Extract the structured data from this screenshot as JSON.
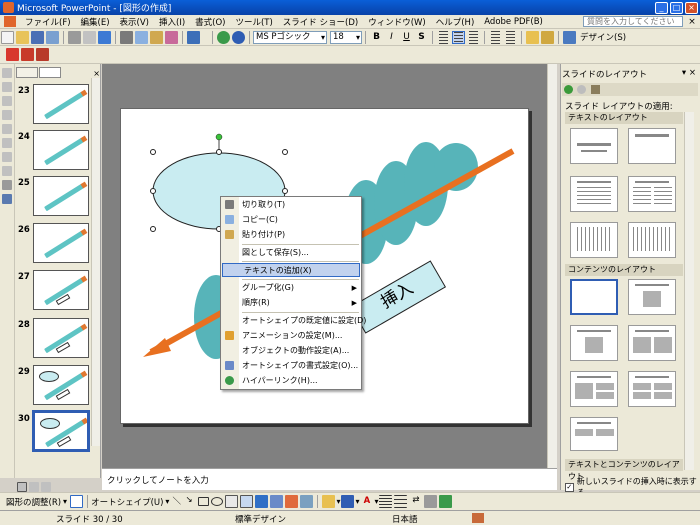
{
  "window": {
    "title": "Microsoft PowerPoint - [図形の作成]",
    "min": "_",
    "max": "□",
    "close": "×"
  },
  "menubar": {
    "items": [
      "ファイル(F)",
      "編集(E)",
      "表示(V)",
      "挿入(I)",
      "書式(O)",
      "ツール(T)",
      "スライド ショー(D)",
      "ウィンドウ(W)",
      "ヘルプ(H)",
      "Adobe PDF(B)"
    ],
    "help_placeholder": "質問を入力してください",
    "close": "×"
  },
  "toolbar": {
    "font_name": "MS Pゴシック",
    "font_size": "18",
    "bold": "B",
    "italic": "I",
    "underline": "U",
    "shadow": "S",
    "design_label": "デザイン(S)"
  },
  "slides_panel": {
    "numbers": [
      "23",
      "24",
      "25",
      "26",
      "27",
      "28",
      "29",
      "30"
    ],
    "selected": "30"
  },
  "slide": {
    "text_label": "挿入"
  },
  "context_menu": {
    "items": [
      {
        "label": "切り取り(T)",
        "icon": "scissors-icon"
      },
      {
        "label": "コピー(C)",
        "icon": "copy-icon"
      },
      {
        "label": "貼り付け(P)",
        "icon": "paste-icon"
      },
      {
        "label": "図として保存(S)...",
        "icon": ""
      },
      {
        "label": "テキストの追加(X)",
        "icon": ""
      },
      {
        "label": "グループ化(G)",
        "icon": ""
      },
      {
        "label": "順序(R)",
        "icon": ""
      },
      {
        "label": "オートシェイプの既定値に設定(D)",
        "icon": ""
      },
      {
        "label": "アニメーションの設定(M)...",
        "icon": "animation-icon"
      },
      {
        "label": "オブジェクトの動作設定(A)...",
        "icon": ""
      },
      {
        "label": "オートシェイプの書式設定(O)...",
        "icon": "format-autoshape-icon"
      },
      {
        "label": "ハイパーリンク(H)...",
        "icon": "hyperlink-icon"
      }
    ],
    "highlighted": "テキストの追加(X)",
    "submenu_arrow": "▶"
  },
  "notes": {
    "placeholder": "クリックしてノートを入力"
  },
  "task_pane": {
    "title": "スライドのレイアウト",
    "subtitle": "スライド レイアウトの適用:",
    "section_text": "テキストのレイアウト",
    "section_content": "コンテンツのレイアウト",
    "section_text_content": "テキストとコンテンツのレイアウト",
    "checkbox_label": "新しいスライドの挿入時に表示する",
    "checkbox_checked": "✓"
  },
  "draw_toolbar": {
    "draw_label": "図形の調整(R)",
    "autoshape_label": "オートシェイプ(U)"
  },
  "status_bar": {
    "slide_info": "スライド 30 / 30",
    "design": "標準デザイン",
    "language": "日本語"
  },
  "colors": {
    "titlebar": "#0842a8",
    "pencil_body": "#5ec4c4",
    "pencil_shade": "#3aa8ad",
    "arrow": "#e87020",
    "ellipse_fill": "#c9ecf1",
    "label_fill": "#c9ecf1",
    "menu_highlight": "#c1d2ee",
    "selection_border": "#2f5db3"
  }
}
